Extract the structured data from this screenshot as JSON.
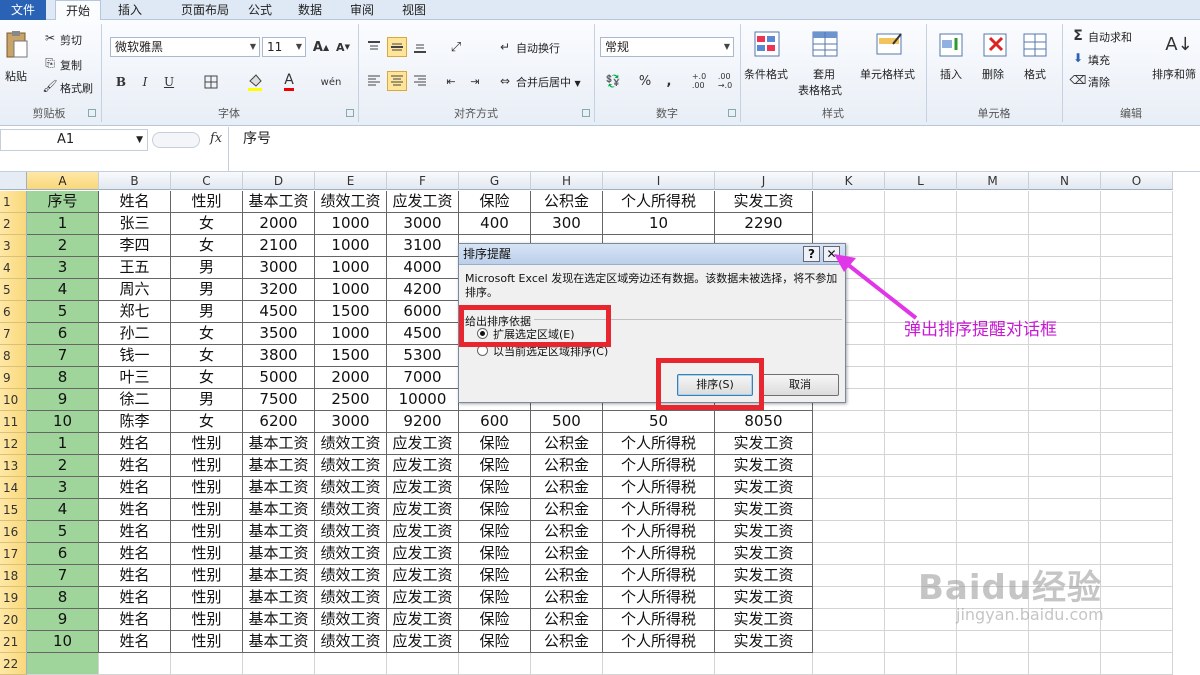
{
  "tabs": [
    "文件",
    "开始",
    "插入",
    "页面布局",
    "公式",
    "数据",
    "审阅",
    "视图"
  ],
  "ribbon": {
    "clipboard": {
      "paste": "粘贴",
      "cut": "剪切",
      "copy": "复制",
      "format_painter": "格式刷",
      "label": "剪贴板"
    },
    "font": {
      "name": "微软雅黑",
      "size": "11",
      "label": "字体"
    },
    "alignment": {
      "wrap": "自动换行",
      "merge": "合并后居中",
      "label": "对齐方式"
    },
    "number": {
      "format": "常规",
      "label": "数字"
    },
    "styles": {
      "conditional": "条件格式",
      "table_fmt_1": "套用",
      "table_fmt_2": "表格格式",
      "cell_style": "单元格样式",
      "label": "样式"
    },
    "cells": {
      "insert": "插入",
      "delete": "删除",
      "format": "格式",
      "label": "单元格"
    },
    "editing": {
      "autosum": "自动求和",
      "fill": "填充",
      "clear": "清除",
      "sort": "排序和筛",
      "label": "编辑"
    }
  },
  "formula_bar": {
    "name_box": "A1",
    "fx": "fx",
    "content": "序号"
  },
  "columns": [
    "A",
    "B",
    "C",
    "D",
    "E",
    "F",
    "G",
    "H",
    "I",
    "J",
    "K",
    "L",
    "M",
    "N",
    "O"
  ],
  "rows": [
    [
      "序号",
      "姓名",
      "性别",
      "基本工资",
      "绩效工资",
      "应发工资",
      "保险",
      "公积金",
      "个人所得税",
      "实发工资"
    ],
    [
      "1",
      "张三",
      "女",
      "2000",
      "1000",
      "3000",
      "400",
      "300",
      "10",
      "2290"
    ],
    [
      "2",
      "李四",
      "女",
      "2100",
      "1000",
      "3100",
      "",
      "",
      "",
      ""
    ],
    [
      "3",
      "王五",
      "男",
      "3000",
      "1000",
      "4000",
      "",
      "",
      "",
      ""
    ],
    [
      "4",
      "周六",
      "男",
      "3200",
      "1000",
      "4200",
      "",
      "",
      "",
      ""
    ],
    [
      "5",
      "郑七",
      "男",
      "4500",
      "1500",
      "6000",
      "",
      "",
      "",
      ""
    ],
    [
      "6",
      "孙二",
      "女",
      "3500",
      "1000",
      "4500",
      "",
      "",
      "",
      ""
    ],
    [
      "7",
      "钱一",
      "女",
      "3800",
      "1500",
      "5300",
      "",
      "",
      "",
      ""
    ],
    [
      "8",
      "叶三",
      "女",
      "5000",
      "2000",
      "7000",
      "",
      "",
      "",
      ""
    ],
    [
      "9",
      "徐二",
      "男",
      "7500",
      "2500",
      "10000",
      "",
      "",
      "",
      ""
    ],
    [
      "10",
      "陈李",
      "女",
      "6200",
      "3000",
      "9200",
      "600",
      "500",
      "50",
      "8050"
    ],
    [
      "1",
      "姓名",
      "性别",
      "基本工资",
      "绩效工资",
      "应发工资",
      "保险",
      "公积金",
      "个人所得税",
      "实发工资"
    ],
    [
      "2",
      "姓名",
      "性别",
      "基本工资",
      "绩效工资",
      "应发工资",
      "保险",
      "公积金",
      "个人所得税",
      "实发工资"
    ],
    [
      "3",
      "姓名",
      "性别",
      "基本工资",
      "绩效工资",
      "应发工资",
      "保险",
      "公积金",
      "个人所得税",
      "实发工资"
    ],
    [
      "4",
      "姓名",
      "性别",
      "基本工资",
      "绩效工资",
      "应发工资",
      "保险",
      "公积金",
      "个人所得税",
      "实发工资"
    ],
    [
      "5",
      "姓名",
      "性别",
      "基本工资",
      "绩效工资",
      "应发工资",
      "保险",
      "公积金",
      "个人所得税",
      "实发工资"
    ],
    [
      "6",
      "姓名",
      "性别",
      "基本工资",
      "绩效工资",
      "应发工资",
      "保险",
      "公积金",
      "个人所得税",
      "实发工资"
    ],
    [
      "7",
      "姓名",
      "性别",
      "基本工资",
      "绩效工资",
      "应发工资",
      "保险",
      "公积金",
      "个人所得税",
      "实发工资"
    ],
    [
      "8",
      "姓名",
      "性别",
      "基本工资",
      "绩效工资",
      "应发工资",
      "保险",
      "公积金",
      "个人所得税",
      "实发工资"
    ],
    [
      "9",
      "姓名",
      "性别",
      "基本工资",
      "绩效工资",
      "应发工资",
      "保险",
      "公积金",
      "个人所得税",
      "实发工资"
    ],
    [
      "10",
      "姓名",
      "性别",
      "基本工资",
      "绩效工资",
      "应发工资",
      "保险",
      "公积金",
      "个人所得税",
      "实发工资"
    ],
    [
      "",
      "",
      "",
      "",
      "",
      "",
      "",
      "",
      "",
      ""
    ]
  ],
  "dialog": {
    "title": "排序提醒",
    "help": "?",
    "close": "✕",
    "message": "Microsoft Excel 发现在选定区域旁边还有数据。该数据未被选择，将不参加排序。",
    "group_label": "给出排序依据",
    "option_expand": "扩展选定区域(E)",
    "option_current": "以当前选定区域排序(C)",
    "sort_button": "排序(S)",
    "cancel_button": "取消"
  },
  "annotation": "弹出排序提醒对话框",
  "watermark": {
    "top": "Baidu经验",
    "bottom": "jingyan.baidu.com"
  },
  "colors": {
    "selection": "#9fd59a",
    "annotation": "#c81ad4",
    "highlight": "#e8262f"
  }
}
